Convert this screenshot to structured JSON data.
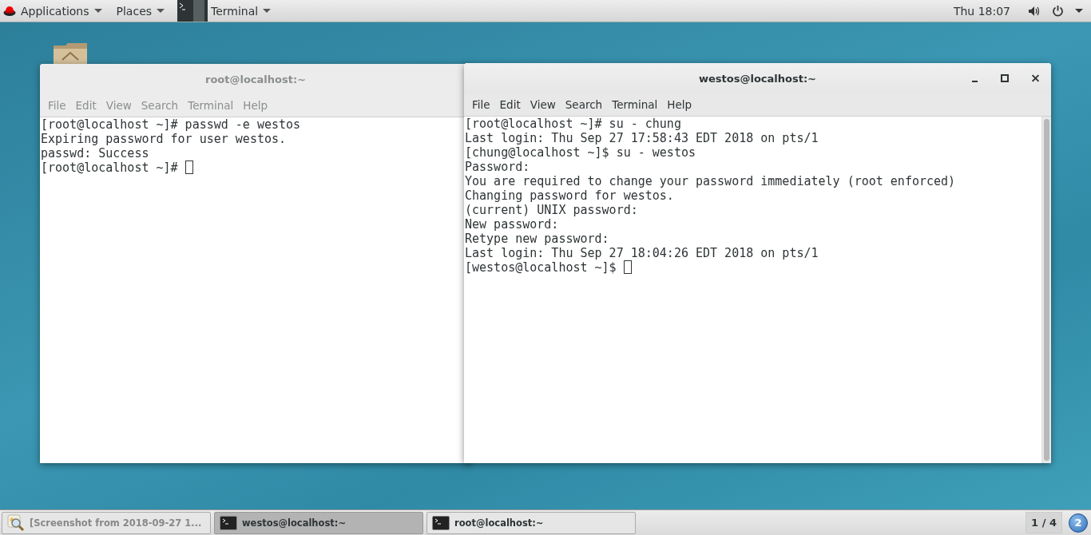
{
  "top_bar": {
    "menus": [
      {
        "label": "Applications",
        "kind": "logo"
      },
      {
        "label": "Places",
        "kind": "plain"
      },
      {
        "label": "Terminal",
        "kind": "app"
      }
    ],
    "clock": "Thu 18:07"
  },
  "windows": [
    {
      "title": "root@localhost:~",
      "active": false,
      "menu": [
        "File",
        "Edit",
        "View",
        "Search",
        "Terminal",
        "Help"
      ],
      "lines": [
        "[root@localhost ~]# passwd -e westos",
        "Expiring password for user westos.",
        "passwd: Success",
        "[root@localhost ~]# "
      ],
      "controls": false,
      "scrollbar": false
    },
    {
      "title": "westos@localhost:~",
      "active": true,
      "menu": [
        "File",
        "Edit",
        "View",
        "Search",
        "Terminal",
        "Help"
      ],
      "lines": [
        "[root@localhost ~]# su - chung",
        "Last login: Thu Sep 27 17:58:43 EDT 2018 on pts/1",
        "[chung@localhost ~]$ su - westos",
        "Password:",
        "You are required to change your password immediately (root enforced)",
        "Changing password for westos.",
        "(current) UNIX password:",
        "New password:",
        "Retype new password:",
        "Last login: Thu Sep 27 18:04:26 EDT 2018 on pts/1",
        "[westos@localhost ~]$ "
      ],
      "controls": true,
      "scrollbar": true
    }
  ],
  "taskbar": {
    "items": [
      {
        "label": "[Screenshot from 2018-09-27 1...",
        "kind": "viewer",
        "selected": false
      },
      {
        "label": "westos@localhost:~",
        "kind": "terminal",
        "selected": true
      },
      {
        "label": "root@localhost:~",
        "kind": "terminal",
        "selected": false
      }
    ],
    "workspace": "1 / 4",
    "badge": "2"
  }
}
